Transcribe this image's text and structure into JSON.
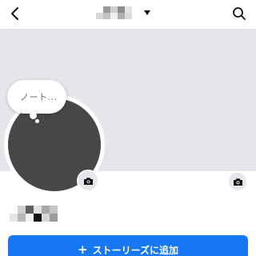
{
  "header": {
    "back_icon": "chevron-left-icon",
    "search_icon": "search-icon",
    "title_redacted": true,
    "dropdown_icon": "caret-down-icon"
  },
  "profile": {
    "note_placeholder": "ノート...",
    "name_redacted": true,
    "cover_camera_icon": "camera-icon",
    "avatar_camera_icon": "camera-icon"
  },
  "actions": {
    "add_story_icon": "plus-icon",
    "add_story_label": "ストーリーズに追加"
  },
  "colors": {
    "accent": "#1877f2",
    "cover_bg": "#e4e6eb",
    "avatar_bg": "#474747",
    "text_muted": "#65676b"
  }
}
